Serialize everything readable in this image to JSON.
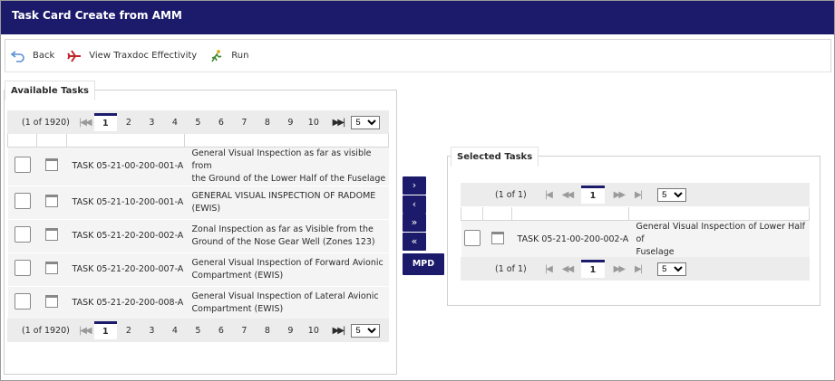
{
  "window": {
    "title": "Task Card Create from AMM"
  },
  "toolbar": {
    "back_label": "Back",
    "view_effectivity_label": "View Traxdoc Effectivity",
    "run_label": "Run"
  },
  "available": {
    "legend": "Available Tasks",
    "pager_count": "(1 of 1920)",
    "pages": [
      "1",
      "2",
      "3",
      "4",
      "5",
      "6",
      "7",
      "8",
      "9",
      "10"
    ],
    "rows_per_page": "5",
    "rows": [
      {
        "task": "TASK 05-21-00-200-001-A",
        "desc1": "General Visual Inspection as far as visible from",
        "desc2": "the Ground of the Lower Half of the Fuselage"
      },
      {
        "task": "TASK 05-21-10-200-001-A",
        "desc1": "GENERAL VISUAL INSPECTION OF RADOME",
        "desc2": "(EWIS)"
      },
      {
        "task": "TASK 05-21-20-200-002-A",
        "desc1": "Zonal Inspection as far as Visible from the",
        "desc2": "Ground of the Nose Gear Well (Zones 123)"
      },
      {
        "task": "TASK 05-21-20-200-007-A",
        "desc1": "General Visual Inspection of Forward Avionic",
        "desc2": "Compartment (EWIS)"
      },
      {
        "task": "TASK 05-21-20-200-008-A",
        "desc1": "General Visual Inspection of Lateral Avionic",
        "desc2": "Compartment (EWIS)"
      }
    ]
  },
  "move": {
    "add_one": "›",
    "remove_one": "‹",
    "add_all": "»",
    "remove_all": "«",
    "mpd_label": "MPD"
  },
  "selected": {
    "legend": "Selected Tasks",
    "pager_count": "(1 of 1)",
    "pages": [
      "1"
    ],
    "rows_per_page": "5",
    "rows": [
      {
        "task": "TASK 05-21-00-200-002-A",
        "desc1": "General Visual Inspection of Lower Half of",
        "desc2": "Fuselage"
      }
    ]
  }
}
